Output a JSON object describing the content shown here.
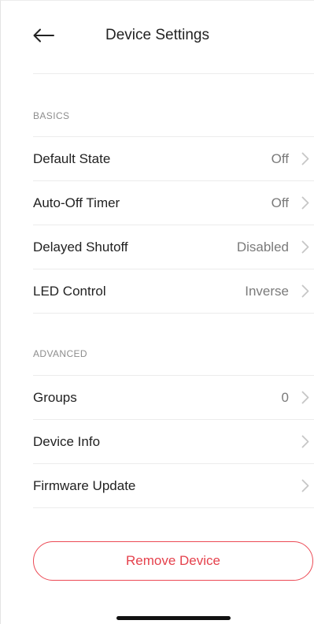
{
  "header": {
    "title": "Device Settings",
    "back_icon": "arrow-left-icon"
  },
  "sections": {
    "basics": {
      "title": "BASICS",
      "rows": [
        {
          "label": "Default State",
          "value": "Off"
        },
        {
          "label": "Auto-Off Timer",
          "value": "Off"
        },
        {
          "label": "Delayed Shutoff",
          "value": "Disabled"
        },
        {
          "label": "LED Control",
          "value": "Inverse"
        }
      ]
    },
    "advanced": {
      "title": "ADVANCED",
      "rows": [
        {
          "label": "Groups",
          "value": "0"
        },
        {
          "label": "Device Info",
          "value": ""
        },
        {
          "label": "Firmware Update",
          "value": ""
        }
      ]
    }
  },
  "remove_button": {
    "label": "Remove Device"
  },
  "colors": {
    "accent": "#e5414c",
    "divider": "#ececec",
    "secondary_text": "#7a7a7a"
  }
}
